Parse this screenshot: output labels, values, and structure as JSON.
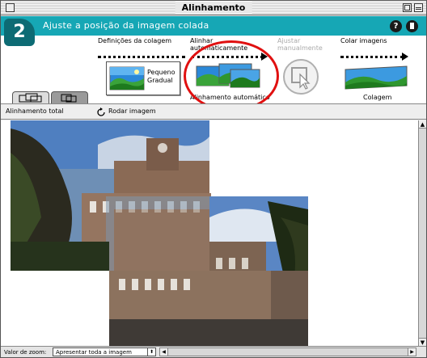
{
  "window": {
    "title": "Alinhamento"
  },
  "header": {
    "step_number": "2",
    "step_title": "Ajuste a posição da imagem colada",
    "help_label": "?"
  },
  "stages": [
    {
      "label": "Definições da colagem",
      "state": "done"
    },
    {
      "label": "Alinhar automaticamente",
      "state": "active"
    },
    {
      "label": "Ajustar manualmente",
      "state": "disabled"
    },
    {
      "label": "Colar imagens",
      "state": "pending"
    }
  ],
  "settings_icon": {
    "caption": "Pequeno Gradual"
  },
  "captions": {
    "auto_align": "Alinhamento automático",
    "collage": "Colagem"
  },
  "toolbar": {
    "align_all": "Alinhamento total",
    "rotate": "Rodar imagem"
  },
  "status": {
    "zoom_label": "Valor de zoom:",
    "zoom_value": "Apresentar toda a imagem"
  },
  "colors": {
    "teal_band": "#16a7b5",
    "badge": "#0d6b74",
    "highlight_circle": "#e01010"
  }
}
